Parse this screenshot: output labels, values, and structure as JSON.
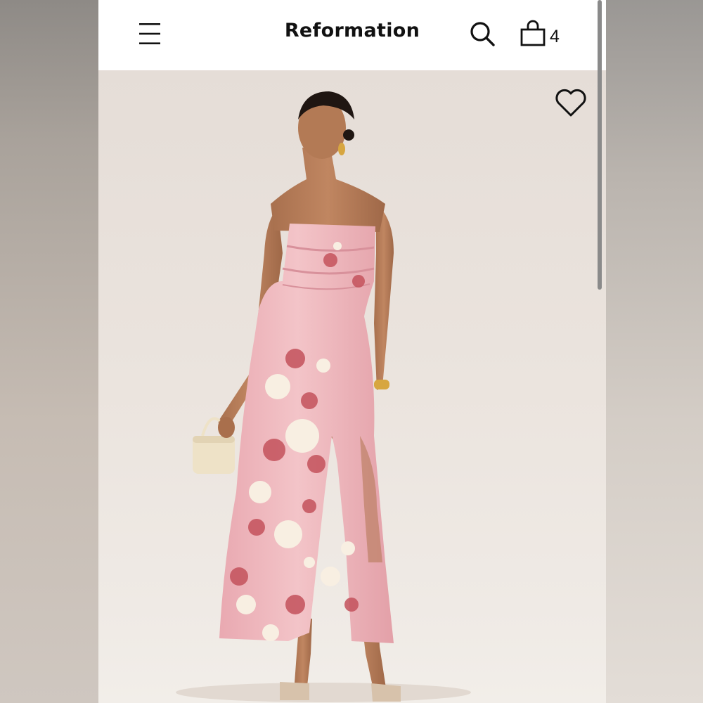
{
  "header": {
    "brand": "Reformation",
    "cart_count": "4",
    "icons": {
      "menu": "hamburger-menu-icon",
      "search": "search-icon",
      "bag": "shopping-bag-icon",
      "wishlist": "heart-outline-icon"
    }
  },
  "product_image": {
    "subject": "model-photo",
    "colors": {
      "dress": "#efb7bd",
      "flower_red": "#c4525c",
      "flower_cream": "#f8efe2",
      "background": "#ebe4de"
    }
  }
}
